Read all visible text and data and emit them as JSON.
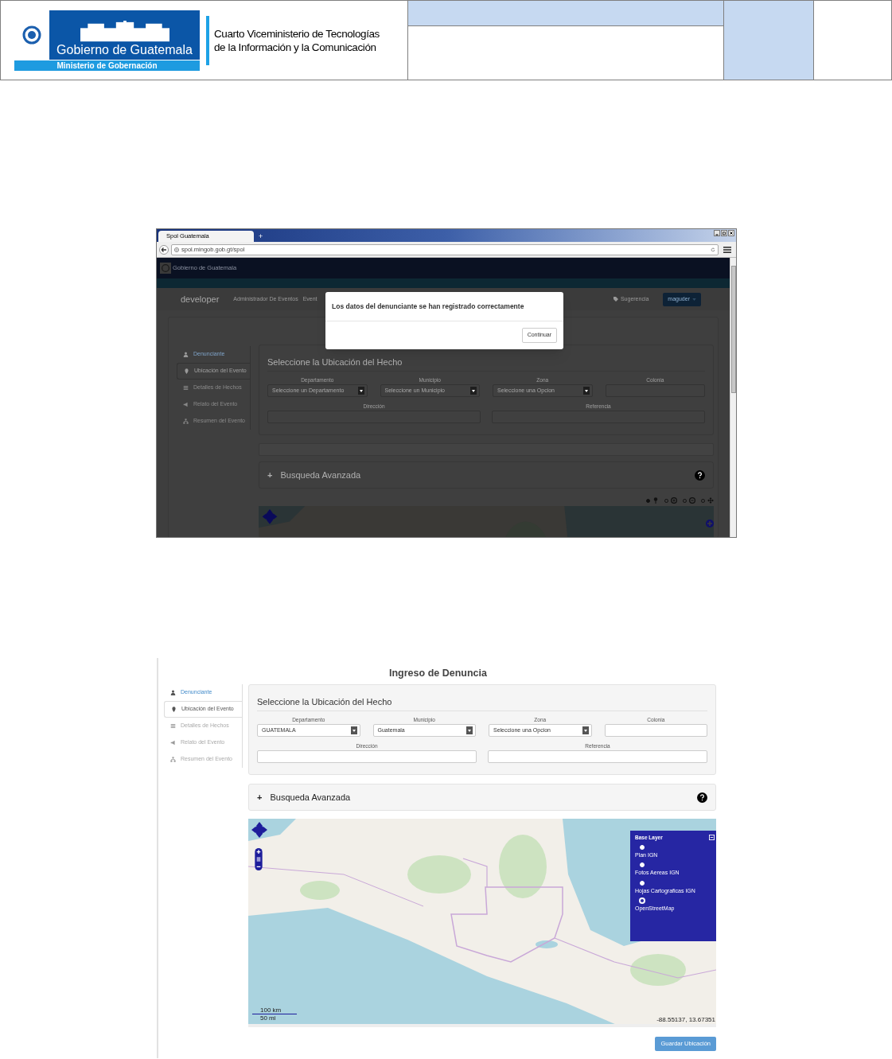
{
  "header": {
    "logo": {
      "title": "Gobierno de Guatemala",
      "subtitle": "Ministerio de Gobernación"
    },
    "agency_lines": [
      "Cuarto Viceministerio de Tecnologías",
      "de la Información y la Comunicación"
    ]
  },
  "screenshot_1": {
    "browser": {
      "tab": "Spol Guatemala",
      "new_tab": "+",
      "url": "spol.mingob.gob.gt/spol"
    },
    "site": {
      "logo_text": "Gobierno de Guatemala",
      "brand": "developer",
      "nav": [
        "Administrador De Eventos",
        "Event"
      ],
      "suggestion": "Sugerencia",
      "user": "maguder"
    },
    "sidebar": [
      {
        "label": "Denunciante",
        "selected": false,
        "disabled": false
      },
      {
        "label": "Ubicación del Evento",
        "selected": true,
        "disabled": false
      },
      {
        "label": "Detalles de Hechos",
        "selected": false,
        "disabled": true
      },
      {
        "label": "Relato del Evento",
        "selected": false,
        "disabled": true
      },
      {
        "label": "Resumen del Evento",
        "selected": false,
        "disabled": true
      }
    ],
    "form": {
      "heading": "Seleccione la Ubicación del Hecho",
      "fields": [
        {
          "label": "Departamento",
          "kind": "select",
          "value": "Seleccione un Departamento"
        },
        {
          "label": "Municipio",
          "kind": "select",
          "value": "Seleccione un Municipio"
        },
        {
          "label": "Zona",
          "kind": "select",
          "value": "Seleccione una Opcion"
        },
        {
          "label": "Colonia",
          "kind": "input"
        },
        {
          "label": "Dirección",
          "kind": "input"
        },
        {
          "label": "Referencia",
          "kind": "input"
        }
      ]
    },
    "advanced": {
      "icon": "+",
      "label": "Busqueda Avanzada"
    },
    "map_tools": [
      {
        "selected": true
      },
      {
        "selected": false
      },
      {
        "selected": false
      },
      {
        "selected": false
      }
    ],
    "modal": {
      "message": "Los datos del denunciante se han registrado correctamente",
      "button": "Continuar"
    }
  },
  "screenshot_2": {
    "title": "Ingreso de Denuncia",
    "sidebar": [
      {
        "label": "Denunciante",
        "selected": false,
        "disabled": false
      },
      {
        "label": "Ubicación del Evento",
        "selected": true,
        "disabled": false
      },
      {
        "label": "Detalles de Hechos",
        "selected": false,
        "disabled": true
      },
      {
        "label": "Relato del Evento",
        "selected": false,
        "disabled": true
      },
      {
        "label": "Resumen del Evento",
        "selected": false,
        "disabled": true
      }
    ],
    "form": {
      "heading": "Seleccione la Ubicación del Hecho",
      "fields": [
        {
          "label": "Departamento",
          "kind": "select",
          "value": "GUATEMALA"
        },
        {
          "label": "Municipio",
          "kind": "select",
          "value": "Guatemala"
        },
        {
          "label": "Zona",
          "kind": "select",
          "value": "Seleccione una Opcion"
        },
        {
          "label": "Colonia",
          "kind": "input"
        },
        {
          "label": "Dirección",
          "kind": "input"
        },
        {
          "label": "Referencia",
          "kind": "input"
        }
      ]
    },
    "advanced": {
      "icon": "+",
      "label": "Busqueda Avanzada"
    },
    "map": {
      "kind": "picture",
      "layers": {
        "title": "Base Layer",
        "items": [
          {
            "label": "Plan IGN",
            "selected": false
          },
          {
            "label": "Fotos Aereas IGN",
            "selected": false
          },
          {
            "label": "Hojas Cartograficas IGN",
            "selected": false
          },
          {
            "label": "OpenStreetMap",
            "selected": true
          }
        ]
      },
      "scale": [
        "100 km",
        "50 mi"
      ],
      "position": "-88.55137, 13.67351"
    },
    "save_button": "Guardar Ubicación"
  }
}
